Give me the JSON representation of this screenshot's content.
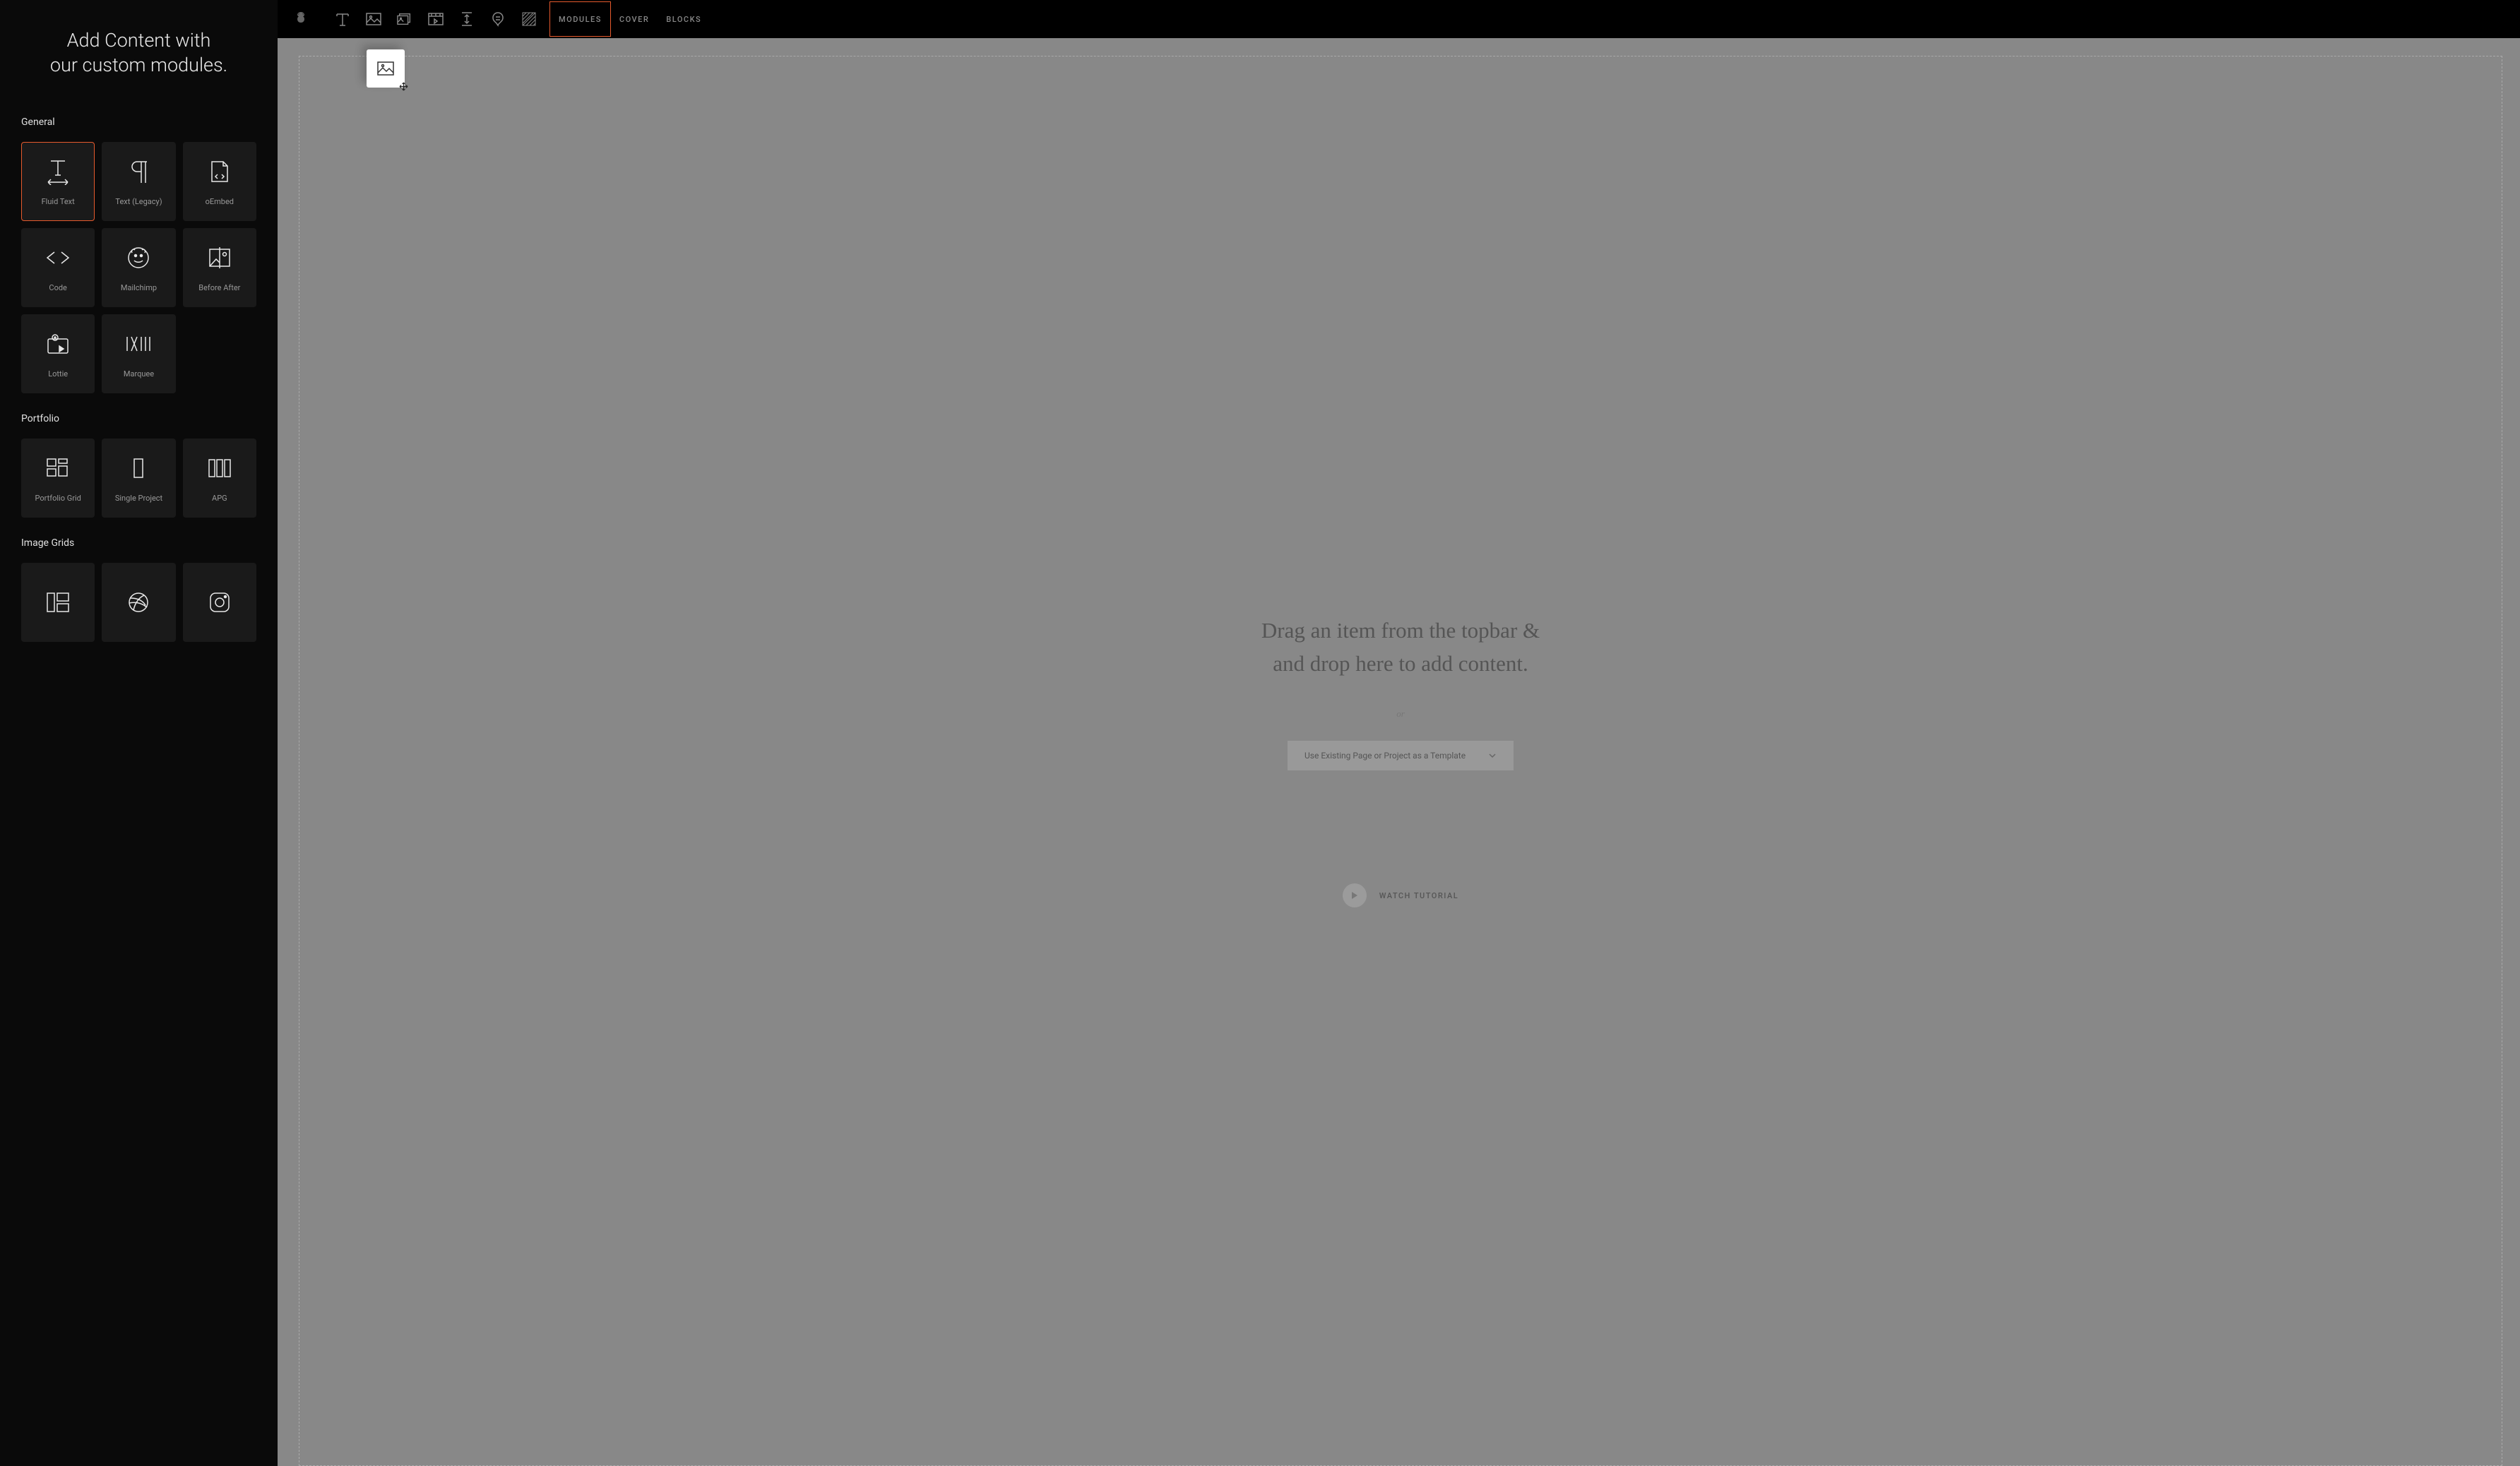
{
  "sidebar": {
    "title_line1": "Add Content with",
    "title_line2": "our custom modules.",
    "sections": {
      "general": {
        "title": "General",
        "items": [
          {
            "label": "Fluid Text",
            "icon": "fluid-text"
          },
          {
            "label": "Text (Legacy)",
            "icon": "paragraph"
          },
          {
            "label": "oEmbed",
            "icon": "embed"
          },
          {
            "label": "Code",
            "icon": "code"
          },
          {
            "label": "Mailchimp",
            "icon": "mailchimp"
          },
          {
            "label": "Before After",
            "icon": "before-after"
          },
          {
            "label": "Lottie",
            "icon": "lottie"
          },
          {
            "label": "Marquee",
            "icon": "marquee"
          }
        ]
      },
      "portfolio": {
        "title": "Portfolio",
        "items": [
          {
            "label": "Portfolio Grid",
            "icon": "grid"
          },
          {
            "label": "Single Project",
            "icon": "single"
          },
          {
            "label": "APG",
            "icon": "columns"
          }
        ]
      },
      "image_grids": {
        "title": "Image Grids"
      }
    }
  },
  "topbar": {
    "tabs": {
      "modules": "MODULES",
      "cover": "COVER",
      "blocks": "BLOCKS"
    }
  },
  "canvas": {
    "drop_line1": "Drag an item from the topbar &",
    "drop_line2": "and drop here to add content.",
    "or": "or",
    "template_label": "Use Existing Page or Project as a Template",
    "tutorial": "WATCH TUTORIAL"
  }
}
